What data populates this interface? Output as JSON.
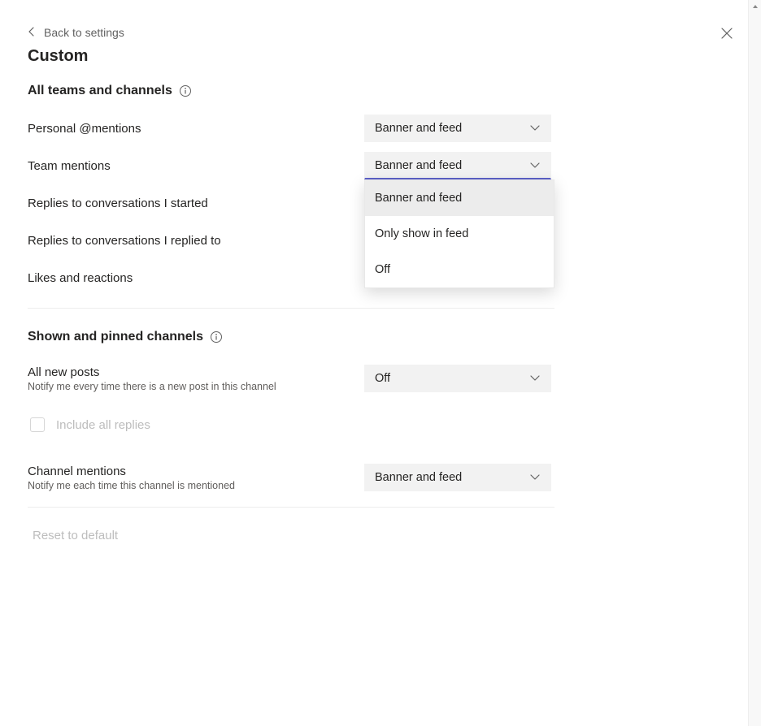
{
  "back_label": "Back to settings",
  "page_title": "Custom",
  "close_icon": "close-icon",
  "sections": {
    "all_teams": {
      "title": "All teams and channels",
      "rows": {
        "personal_mentions": {
          "label": "Personal @mentions",
          "value": "Banner and feed"
        },
        "team_mentions": {
          "label": "Team mentions",
          "value": "Banner and feed"
        },
        "replies_started": {
          "label": "Replies to conversations I started"
        },
        "replies_replied": {
          "label": "Replies to conversations I replied to"
        },
        "likes": {
          "label": "Likes and reactions"
        }
      },
      "dropdown_options": {
        "opt1": "Banner and feed",
        "opt2": "Only show in feed",
        "opt3": "Off"
      }
    },
    "shown_pinned": {
      "title": "Shown and pinned channels",
      "rows": {
        "all_new_posts": {
          "label": "All new posts",
          "sub": "Notify me every time there is a new post in this channel",
          "value": "Off"
        },
        "channel_mentions": {
          "label": "Channel mentions",
          "sub": "Notify me each time this channel is mentioned",
          "value": "Banner and feed"
        }
      },
      "include_replies_label": "Include all replies"
    }
  },
  "reset_label": "Reset to default"
}
